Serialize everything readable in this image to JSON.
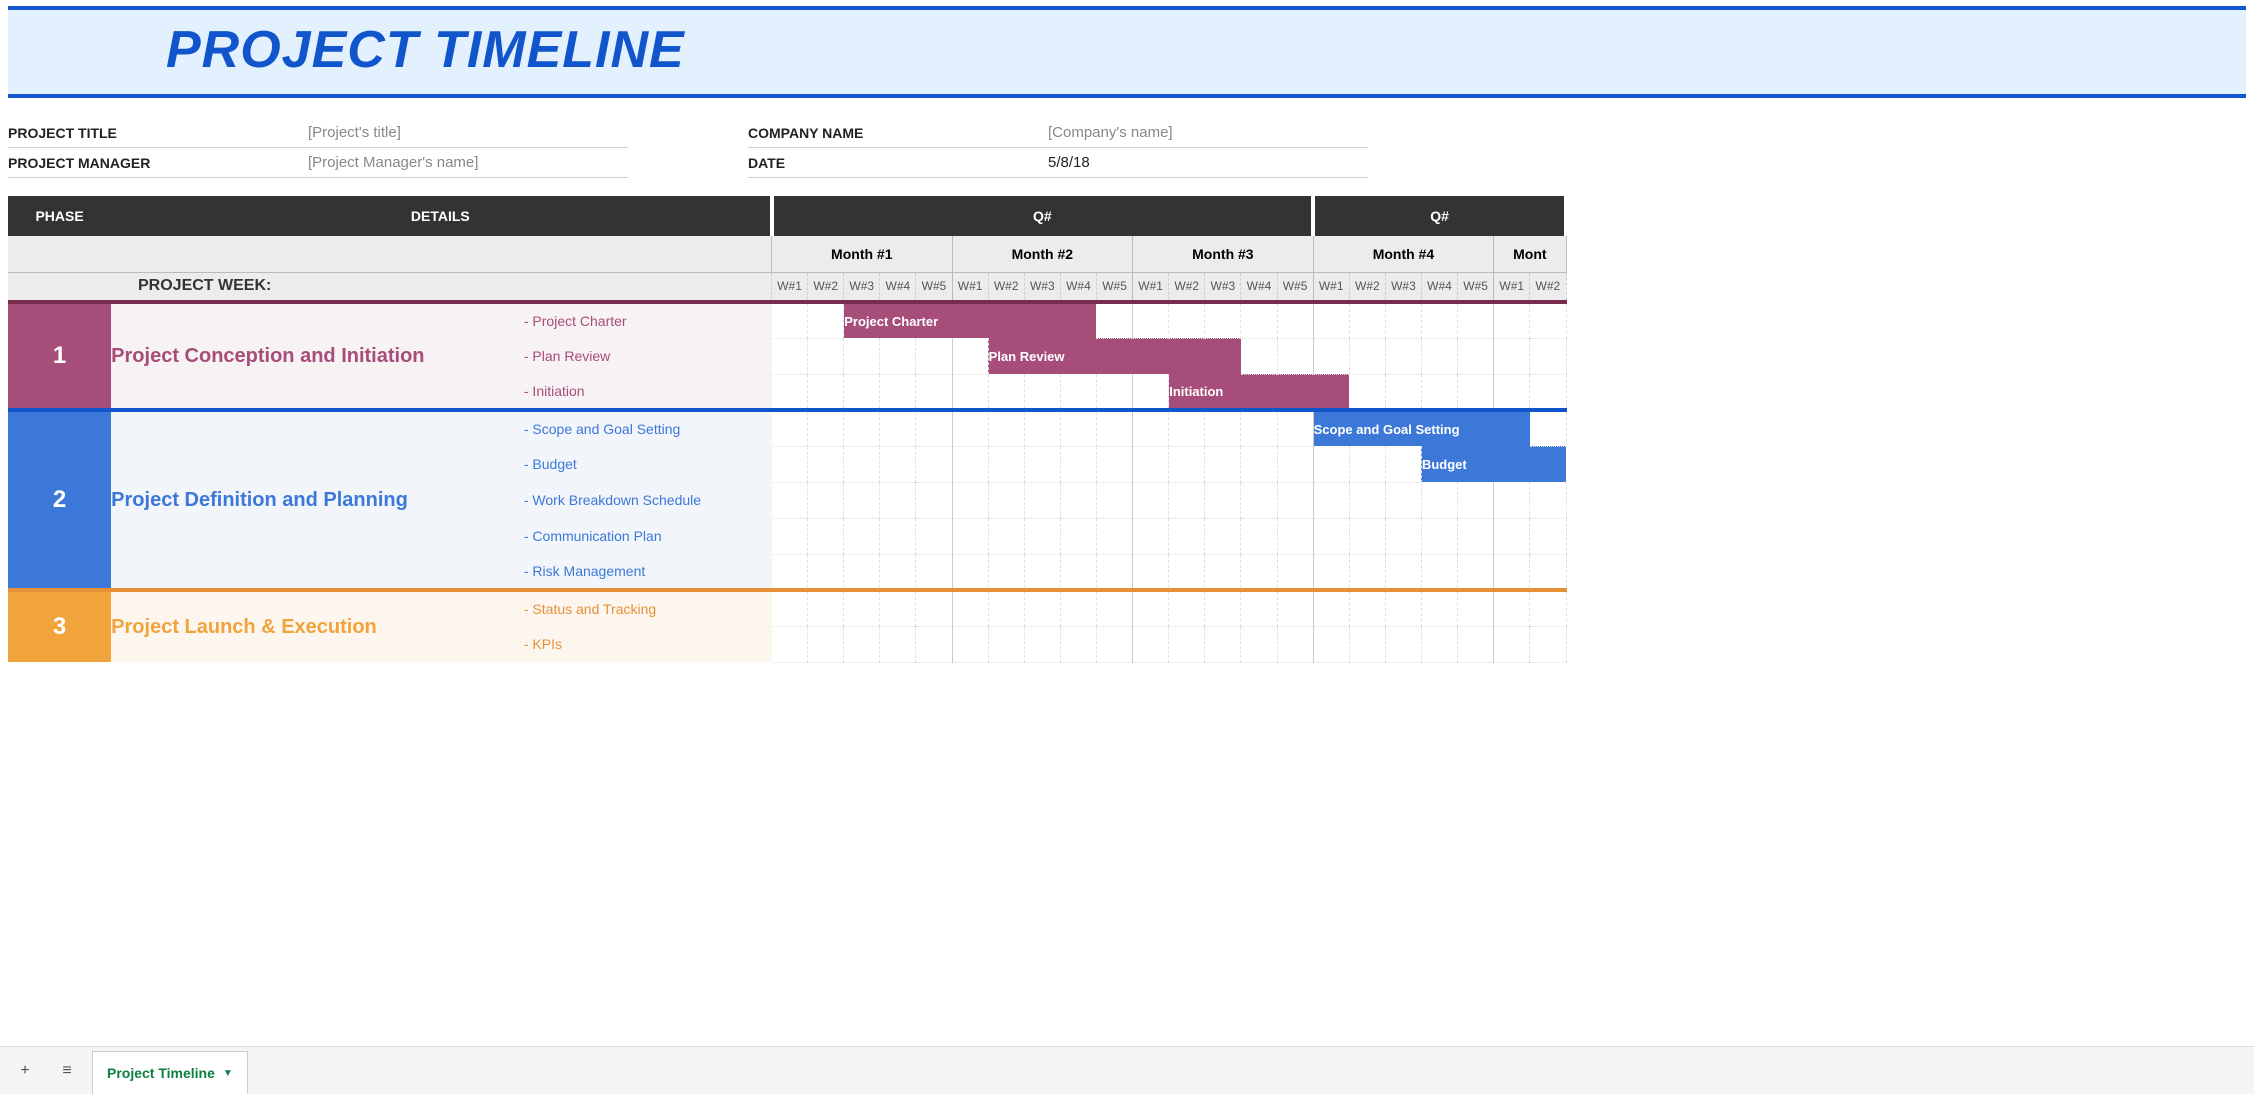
{
  "header": {
    "title": "PROJECT TIMELINE"
  },
  "meta": {
    "left": [
      {
        "label": "PROJECT TITLE",
        "value": "[Project's title]",
        "filled": false
      },
      {
        "label": "PROJECT MANAGER",
        "value": "[Project Manager's name]",
        "filled": false
      }
    ],
    "right": [
      {
        "label": "COMPANY NAME",
        "value": "[Company's name]",
        "filled": false
      },
      {
        "label": "DATE",
        "value": "5/8/18",
        "filled": true
      }
    ]
  },
  "columns": {
    "phase": "PHASE",
    "details": "DETAILS",
    "project_week": "PROJECT WEEK:",
    "quarters": [
      "Q#",
      "Q#"
    ],
    "months": [
      "Month #1",
      "Month #2",
      "Month #3",
      "Month #4",
      "Mont"
    ],
    "weeks": [
      "W#1",
      "W#2",
      "W#3",
      "W#4",
      "W#5",
      "W#1",
      "W#2",
      "W#3",
      "W#4",
      "W#5",
      "W#1",
      "W#2",
      "W#3",
      "W#4",
      "W#5",
      "W#1",
      "W#2",
      "W#3",
      "W#4",
      "W#5",
      "W#1",
      "W#2"
    ]
  },
  "phases": [
    {
      "num": "1",
      "title": "Project Conception and Initiation",
      "color_class": "phase-1",
      "details": [
        {
          "label": "- Project Charter",
          "bar": {
            "label": "Project Charter",
            "start": 2,
            "span": 7,
            "cls": "bar-p1"
          }
        },
        {
          "label": "- Plan Review",
          "bar": {
            "label": "Plan Review",
            "start": 6,
            "span": 7,
            "cls": "bar-p1"
          }
        },
        {
          "label": "- Initiation",
          "bar": {
            "label": "Initiation",
            "start": 11,
            "span": 5,
            "cls": "bar-p1"
          }
        }
      ]
    },
    {
      "num": "2",
      "title": "Project Definition and Planning",
      "color_class": "phase-2",
      "details": [
        {
          "label": "- Scope and Goal Setting",
          "bar": {
            "label": "Scope and Goal Setting",
            "start": 15,
            "span": 6,
            "cls": "bar-p2"
          }
        },
        {
          "label": "- Budget",
          "bar": {
            "label": "Budget",
            "start": 18,
            "span": 4,
            "cls": "bar-p2"
          }
        },
        {
          "label": "- Work Breakdown Schedule",
          "bar": null
        },
        {
          "label": "- Communication Plan",
          "bar": null
        },
        {
          "label": "- Risk Management",
          "bar": null
        }
      ]
    },
    {
      "num": "3",
      "title": "Project Launch & Execution",
      "color_class": "phase-3",
      "details": [
        {
          "label": "- Status and Tracking",
          "bar": null
        },
        {
          "label": "- KPIs",
          "bar": null
        }
      ]
    }
  ],
  "bottom": {
    "add_icon": "+",
    "menu_icon": "≡",
    "tab_name": "Project Timeline",
    "tab_chevron": "▼"
  }
}
